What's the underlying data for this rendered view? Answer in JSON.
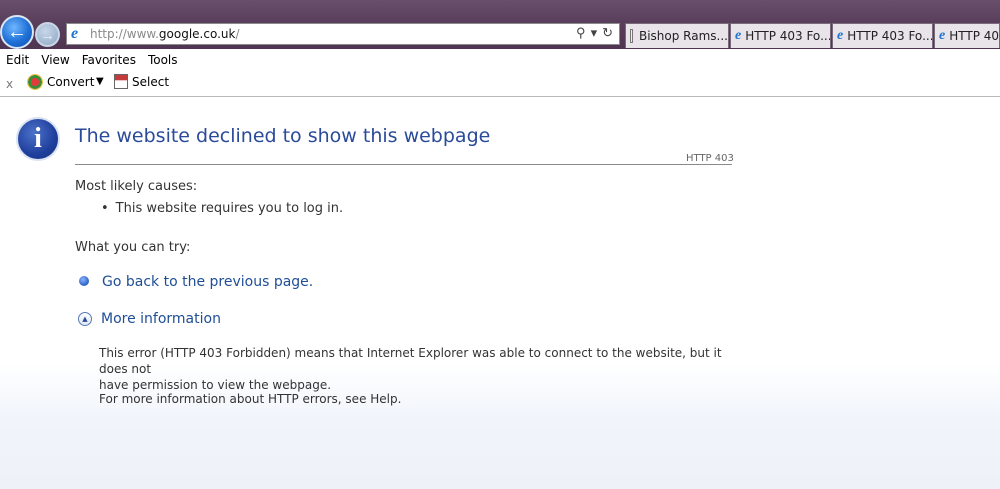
{
  "browser": {
    "address": {
      "prefix": "http://www.",
      "domain": "google.co.uk",
      "suffix": "/"
    },
    "address_tools": {
      "search_glyph": "⚲",
      "dropdown_glyph": "▾",
      "refresh_glyph": "↻"
    },
    "back_glyph": "←",
    "forward_glyph": "→",
    "ie_glyph": "e",
    "tabs": [
      {
        "label": "Bishop Rams..."
      },
      {
        "label": "HTTP 403 Fo..."
      },
      {
        "label": "HTTP 403 Fo..."
      },
      {
        "label": "HTTP 40"
      }
    ]
  },
  "menu": {
    "items": [
      "Edit",
      "View",
      "Favorites",
      "Tools"
    ]
  },
  "command_bar": {
    "close_glyph": "x",
    "convert_label": "Convert",
    "dropdown_glyph": "▼",
    "select_label": "Select"
  },
  "page": {
    "info_glyph": "i",
    "title": "The website declined to show this webpage",
    "code": "HTTP 403",
    "causes_heading": "Most likely causes:",
    "cause_bullet": "•",
    "causes": [
      "This website requires you to log in."
    ],
    "try_heading": "What you can try:",
    "back_link": "Go back to the previous page.",
    "more_info_glyph": "▲",
    "more_info": "More information",
    "explanation_line1": "This error (HTTP 403 Forbidden) means that Internet Explorer was able to connect to the website, but it does not",
    "explanation_line2": "have permission to view the webpage.",
    "help_text": "For more information about HTTP errors, see Help."
  },
  "colors": {
    "title_bar": "#5a3f5c",
    "link": "#1f4e96",
    "title": "#2a4a9a",
    "body_text": "#333333"
  }
}
